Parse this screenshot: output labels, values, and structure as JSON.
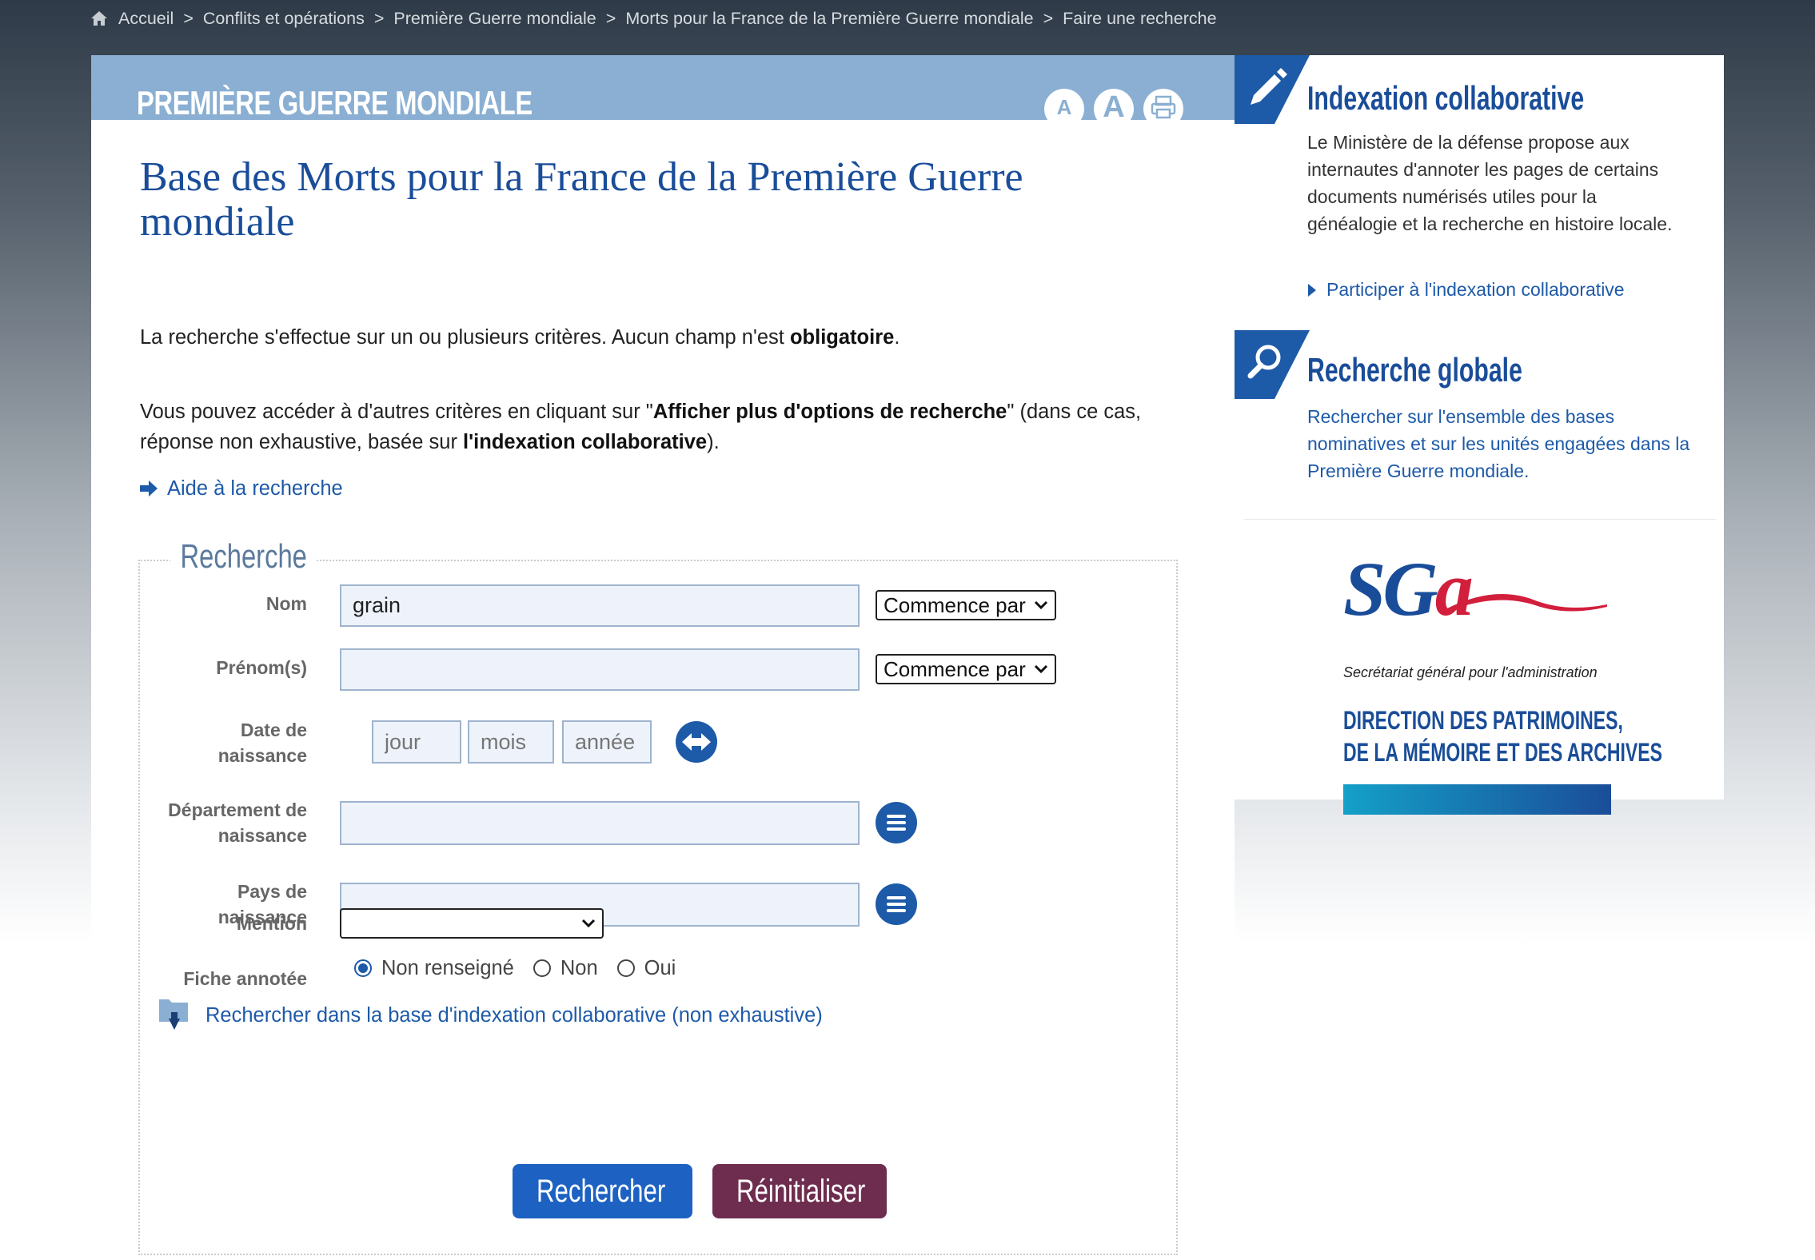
{
  "breadcrumb": {
    "items": [
      "Accueil",
      "Conflits et opérations",
      "Première Guerre mondiale",
      "Morts pour la France de la Première Guerre mondiale",
      "Faire une recherche"
    ],
    "separator": ">"
  },
  "header": {
    "section_title": "PREMIÈRE GUERRE MONDIALE",
    "text_small": "A",
    "text_large": "A"
  },
  "main": {
    "title": "Base des Morts pour la France de la Première Guerre mondiale",
    "intro1_pre": "La recherche s'effectue sur un ou plusieurs critères. Aucun champ n'est ",
    "intro1_bold": "obligatoire",
    "intro1_post": ".",
    "intro2_pre": "Vous pouvez accéder à d'autres critères en cliquant sur \"",
    "intro2_bold1": "Afficher plus d'options de recherche",
    "intro2_mid": "\" (dans ce cas, réponse non exhaustive, basée sur ",
    "intro2_bold2": "l'indexation collaborative",
    "intro2_post": ").",
    "help_link": "Aide à la recherche"
  },
  "form": {
    "legend": "Recherche",
    "nom_label": "Nom",
    "nom_value": "grain",
    "nom_mode": "Commence par",
    "prenom_label": "Prénom(s)",
    "prenom_value": "",
    "prenom_mode": "Commence par",
    "date_label_1": "Date de",
    "date_label_2": "naissance",
    "date_day_placeholder": "jour",
    "date_month_placeholder": "mois",
    "date_year_placeholder": "année",
    "dept_label_1": "Département de",
    "dept_label_2": "naissance",
    "pays_label_1": "Pays de",
    "pays_label_2": "naissance",
    "mention_label": "Mention",
    "mention_value": "",
    "fiche_label": "Fiche annotée",
    "fiche_options": [
      "Non renseigné",
      "Non",
      "Oui"
    ],
    "fiche_selected": "Non renseigné",
    "collab_link": "Rechercher dans la base d'indexation collaborative (non exhaustive)",
    "search_button": "Rechercher",
    "reset_button": "Réinitialiser"
  },
  "sidebar": {
    "indexation_title": "Indexation collaborative",
    "indexation_text": "Le Ministère de la défense propose aux internautes d'annoter les pages de certains documents numérisés utiles pour la généalogie et la recherche en histoire locale.",
    "indexation_link": "Participer à l'indexation collaborative",
    "global_title": "Recherche globale",
    "global_text": "Rechercher sur l'ensemble des bases nominatives et sur les unités engagées dans la Première Guerre mondiale.",
    "sga_logo": "SGA",
    "sga_subtitle": "Secrétariat général pour l'administration",
    "sga_direction_1": "DIRECTION DES PATRIMOINES,",
    "sga_direction_2": "DE LA MÉMOIRE ET DES ARCHIVES"
  },
  "colors": {
    "accent_blue": "#1d5aa8",
    "header_blue": "#8aafd2",
    "title_blue": "#1a4d99",
    "reset_purple": "#6e2d4e",
    "sga_red": "#d21f3c"
  },
  "icons": [
    "home-icon",
    "print-icon",
    "arrow-right-icon",
    "swap-arrows-icon",
    "list-icon",
    "folder-download-icon",
    "search-icon",
    "close-icon",
    "pencil-icon",
    "magnifier-icon",
    "caret-right-icon",
    "chevron-down-icon"
  ]
}
